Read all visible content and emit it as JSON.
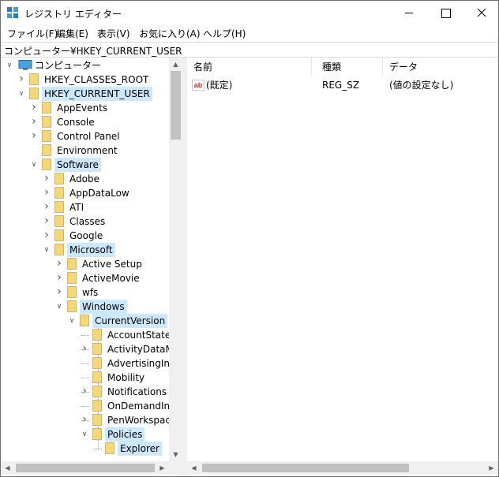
{
  "window": {
    "title": "レジストリ エディター",
    "icon": "registry-editor-icon"
  },
  "menu": [
    "ファイル(F)",
    "編集(E)",
    "表示(V)",
    "お気に入り(A)",
    "ヘルプ(H)"
  ],
  "address": "コンピューター¥HKEY_CURRENT_USER",
  "tree": {
    "root": "コンピューター",
    "nodes": [
      {
        "label": "HKEY_CLASSES_ROOT",
        "expanded": false,
        "selected": false
      },
      {
        "label": "HKEY_CURRENT_USER",
        "expanded": true,
        "selected": true
      },
      {
        "label": "AppEvents",
        "expanded": false,
        "selected": false
      },
      {
        "label": "Console",
        "expanded": false,
        "selected": false
      },
      {
        "label": "Control Panel",
        "expanded": false,
        "selected": false
      },
      {
        "label": "Environment",
        "expanded": false,
        "selected": false
      },
      {
        "label": "Software",
        "expanded": true,
        "selected": true
      },
      {
        "label": "Adobe",
        "expanded": false,
        "selected": false
      },
      {
        "label": "AppDataLow",
        "expanded": false,
        "selected": false
      },
      {
        "label": "ATI",
        "expanded": false,
        "selected": false
      },
      {
        "label": "Classes",
        "expanded": false,
        "selected": false
      },
      {
        "label": "Google",
        "expanded": false,
        "selected": false
      },
      {
        "label": "Microsoft",
        "expanded": true,
        "selected": true
      },
      {
        "label": "Active Setup",
        "expanded": false,
        "selected": false
      },
      {
        "label": "ActiveMovie",
        "expanded": false,
        "selected": false
      },
      {
        "label": "wfs",
        "expanded": false,
        "selected": false
      },
      {
        "label": "Windows",
        "expanded": true,
        "selected": true
      },
      {
        "label": "CurrentVersion",
        "expanded": true,
        "selected": true
      },
      {
        "label": "AccountState",
        "expanded": false,
        "selected": false
      },
      {
        "label": "ActivityDataM",
        "expanded": false,
        "selected": false
      },
      {
        "label": "AdvertisingInf",
        "expanded": false,
        "selected": false
      },
      {
        "label": "Mobility",
        "expanded": false,
        "selected": false
      },
      {
        "label": "Notifications",
        "expanded": false,
        "selected": false
      },
      {
        "label": "OnDemandInt",
        "expanded": false,
        "selected": false
      },
      {
        "label": "PenWorkspace",
        "expanded": false,
        "selected": false
      },
      {
        "label": "Policies",
        "expanded": true,
        "selected": true
      },
      {
        "label": "Explorer",
        "expanded": false,
        "selected": true
      }
    ]
  },
  "list": {
    "columns": [
      "名前",
      "種類",
      "データ"
    ],
    "rows": [
      {
        "name": "(既定)",
        "type": "REG_SZ",
        "data": "(値の設定なし)"
      }
    ]
  },
  "colors": {
    "selection": "#cce8ff",
    "folder": "#f5d779",
    "folder_edge": "#d8b655"
  }
}
